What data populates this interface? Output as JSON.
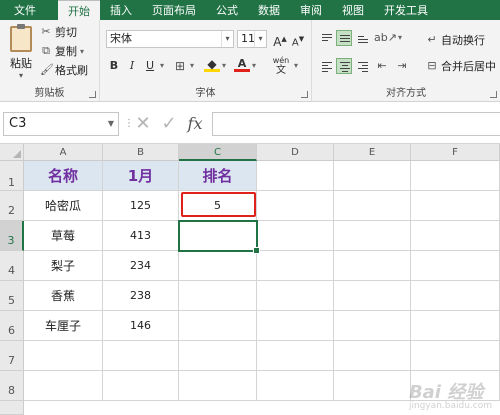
{
  "ribbon_tabs": [
    "文件",
    "开始",
    "插入",
    "页面布局",
    "公式",
    "数据",
    "审阅",
    "视图",
    "开发工具"
  ],
  "active_tab": "开始",
  "clipboard": {
    "paste_label": "粘贴",
    "cut_label": "剪切",
    "copy_label": "复制",
    "format_painter_label": "格式刷",
    "group_label": "剪贴板"
  },
  "font": {
    "name": "宋体",
    "size": "11",
    "grow_label": "A",
    "shrink_label": "A",
    "bold_label": "B",
    "italic_label": "I",
    "underline_label": "U",
    "phonetic_label": "wén",
    "font_color_label": "A",
    "group_label": "字体"
  },
  "alignment": {
    "wrap_text_label": "自动换行",
    "merge_center_label": "合并后居中",
    "group_label": "对齐方式"
  },
  "formula_bar": {
    "name_box": "C3",
    "fx_label": "fx",
    "formula": ""
  },
  "columns": [
    "A",
    "B",
    "C",
    "D",
    "E",
    "F"
  ],
  "rows": [
    "1",
    "2",
    "3",
    "4",
    "5",
    "6",
    "7",
    "8"
  ],
  "table": {
    "headers": [
      "名称",
      "1月",
      "排名"
    ],
    "items": [
      {
        "name": "哈密瓜",
        "jan": "125",
        "rank": "5"
      },
      {
        "name": "草莓",
        "jan": "413",
        "rank": ""
      },
      {
        "name": "梨子",
        "jan": "234",
        "rank": ""
      },
      {
        "name": "香蕉",
        "jan": "238",
        "rank": ""
      },
      {
        "name": "车厘子",
        "jan": "146",
        "rank": ""
      }
    ]
  },
  "watermark": {
    "main": "Bai 经验",
    "sub": "jingyan.baidu.com"
  },
  "colors": {
    "excel_green": "#217346",
    "header_fill": "#dce6f1",
    "header_text": "#7030a0",
    "highlight": "#e0201b"
  }
}
